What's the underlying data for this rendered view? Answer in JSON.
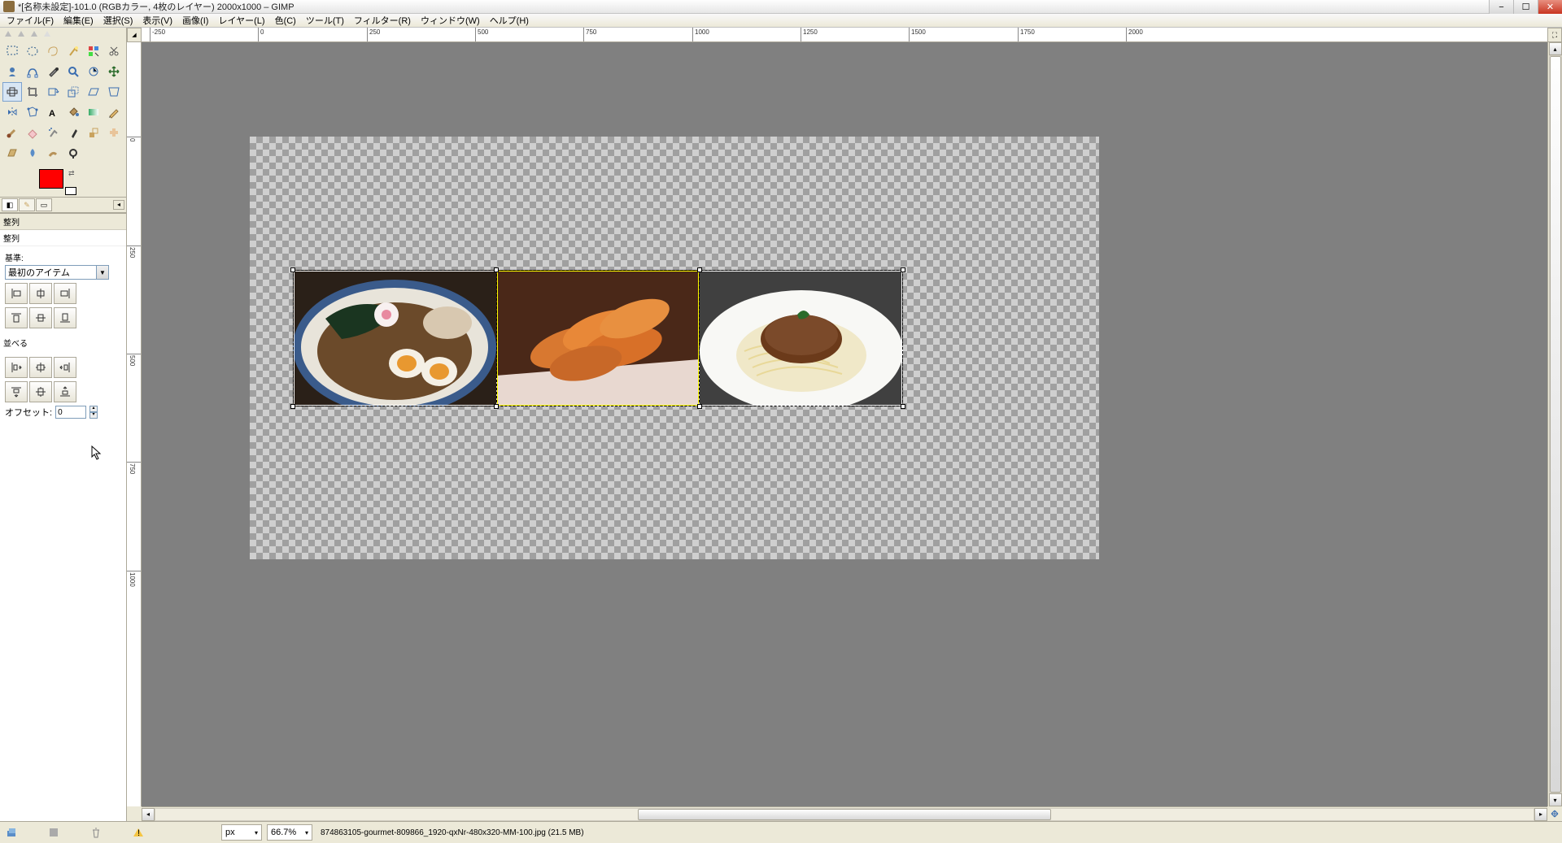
{
  "title": "*[名称未設定]-101.0 (RGBカラー, 4枚のレイヤー) 2000x1000 – GIMP",
  "menu": [
    "ファイル(F)",
    "編集(E)",
    "選択(S)",
    "表示(V)",
    "画像(I)",
    "レイヤー(L)",
    "色(C)",
    "ツール(T)",
    "フィルター(R)",
    "ウィンドウ(W)",
    "ヘルプ(H)"
  ],
  "ruler_h": [
    "-250",
    "0",
    "250",
    "500",
    "750",
    "1000",
    "1250",
    "1500",
    "1750",
    "2000"
  ],
  "ruler_v": [
    "0",
    "250",
    "500",
    "750",
    "1000"
  ],
  "options": {
    "title": "整列",
    "section1_title": "整列",
    "ref_label": "基準:",
    "ref_select": "最初のアイテム",
    "section2_title": "並べる",
    "offset_label": "オフセット:",
    "offset_value": "0"
  },
  "status": {
    "unit": "px",
    "zoom": "66.7%",
    "file": "874863105-gourmet-809866_1920-qxNr-480x320-MM-100.jpg (21.5 MB)"
  },
  "colors": {
    "fg": "#ff0000",
    "bg": "#ffffff"
  }
}
